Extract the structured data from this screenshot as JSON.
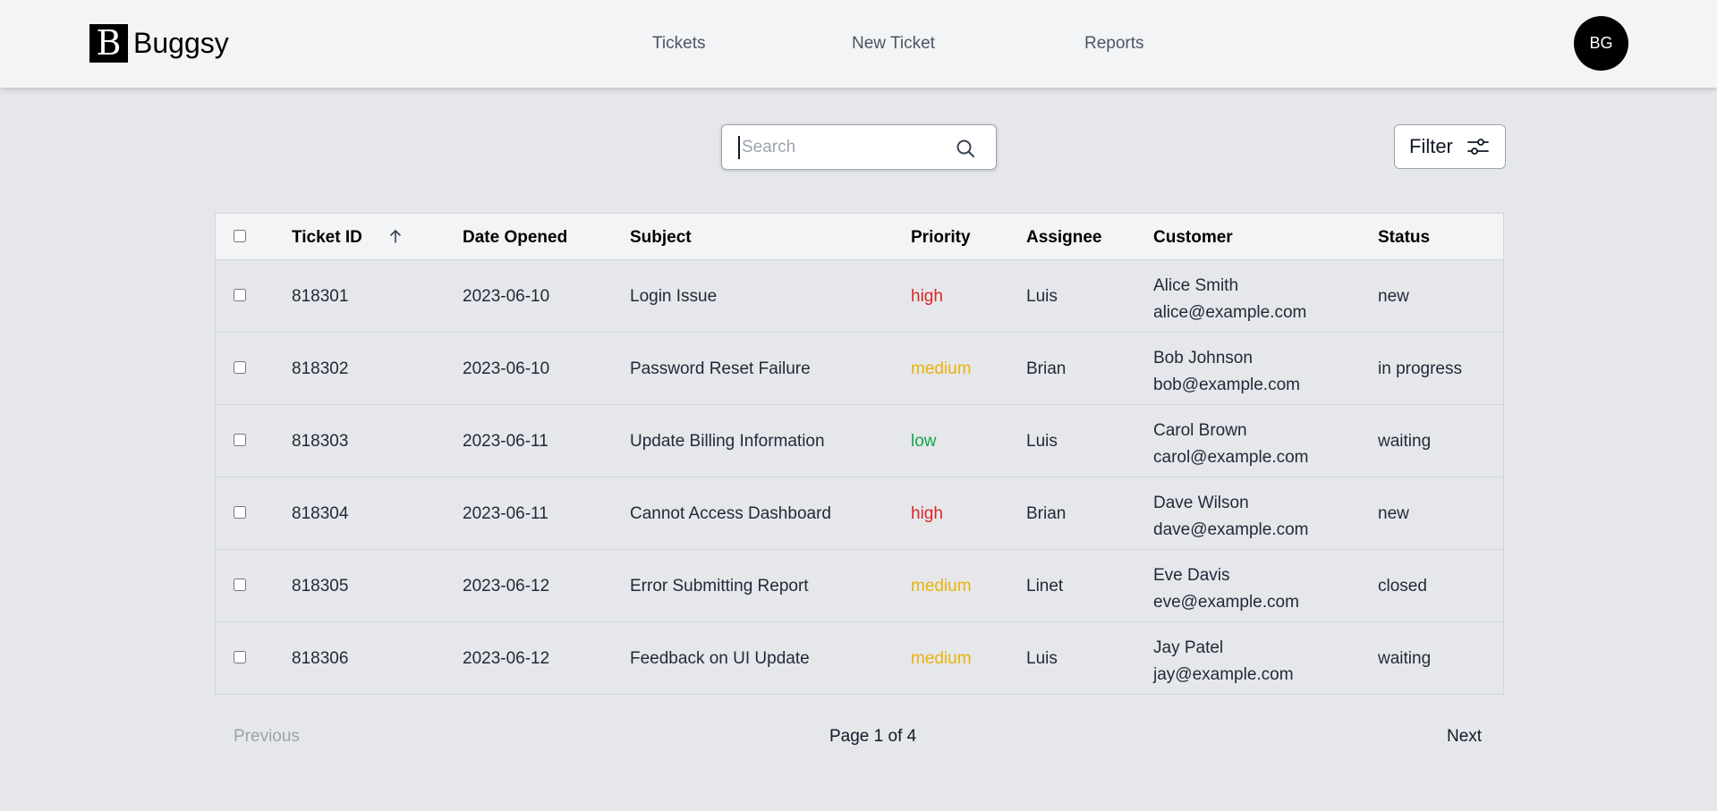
{
  "app": {
    "logo_letter": "B",
    "name": "Buggsy",
    "nav": [
      "Tickets",
      "New Ticket",
      "Reports"
    ],
    "avatar_initials": "BG"
  },
  "search": {
    "value": "",
    "placeholder": "Search",
    "icon": "search-icon"
  },
  "filter": {
    "label": "Filter",
    "icon": "sliders-icon"
  },
  "table": {
    "columns": [
      "Ticket ID",
      "Date Opened",
      "Subject",
      "Priority",
      "Assignee",
      "Customer",
      "Status"
    ],
    "sort": {
      "column": "Ticket ID",
      "direction": "ascending"
    },
    "rows": [
      {
        "id": "818301",
        "date": "2023-06-10",
        "subject": "Login Issue",
        "priority": "high",
        "assignee": "Luis",
        "customer_name": "Alice Smith",
        "customer_email": "alice@example.com",
        "status": "new"
      },
      {
        "id": "818302",
        "date": "2023-06-10",
        "subject": "Password Reset Failure",
        "priority": "medium",
        "assignee": "Brian",
        "customer_name": "Bob Johnson",
        "customer_email": "bob@example.com",
        "status": "in progress"
      },
      {
        "id": "818303",
        "date": "2023-06-11",
        "subject": "Update Billing Information",
        "priority": "low",
        "assignee": "Luis",
        "customer_name": "Carol Brown",
        "customer_email": "carol@example.com",
        "status": "waiting"
      },
      {
        "id": "818304",
        "date": "2023-06-11",
        "subject": "Cannot Access Dashboard",
        "priority": "high",
        "assignee": "Brian",
        "customer_name": "Dave Wilson",
        "customer_email": "dave@example.com",
        "status": "new"
      },
      {
        "id": "818305",
        "date": "2023-06-12",
        "subject": "Error Submitting Report",
        "priority": "medium",
        "assignee": "Linet",
        "customer_name": "Eve Davis",
        "customer_email": "eve@example.com",
        "status": "closed"
      },
      {
        "id": "818306",
        "date": "2023-06-12",
        "subject": "Feedback on UI Update",
        "priority": "medium",
        "assignee": "Luis",
        "customer_name": "Jay Patel",
        "customer_email": "jay@example.com",
        "status": "waiting"
      }
    ]
  },
  "priority_colors": {
    "high": "#dc2626",
    "medium": "#eab308",
    "low": "#16a34a"
  },
  "pagination": {
    "previous": "Previous",
    "page_text": "Page 1 of 4",
    "next": "Next",
    "previous_disabled": true
  }
}
